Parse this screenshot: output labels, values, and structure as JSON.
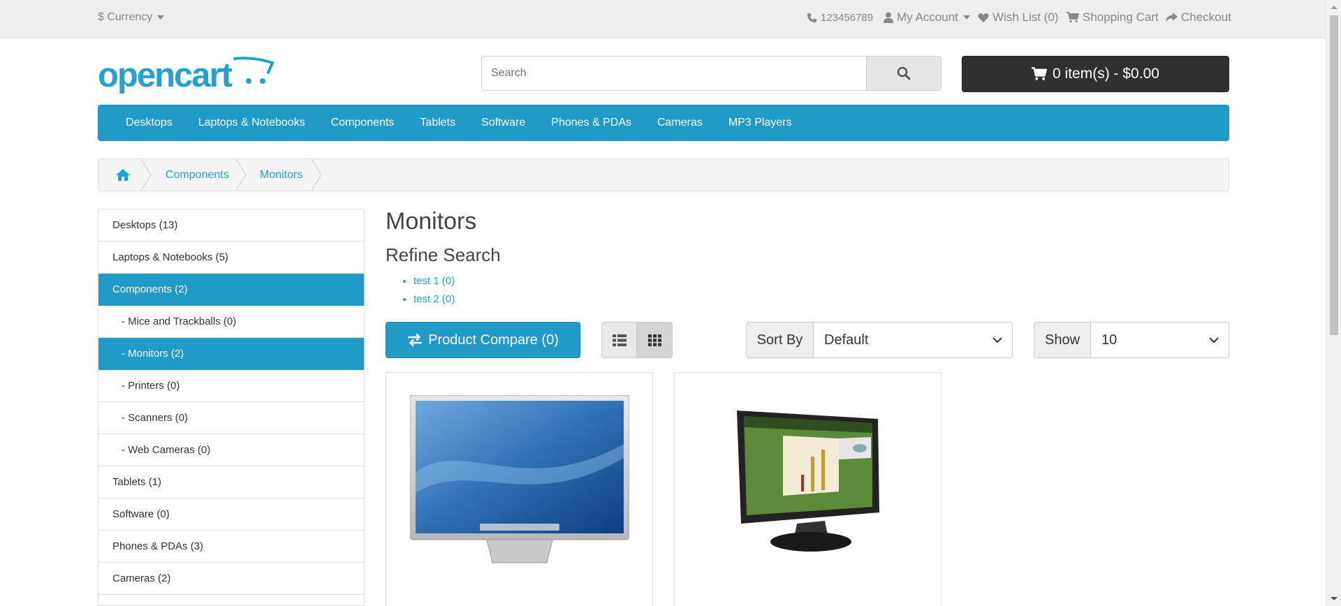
{
  "top_bar": {
    "currency": "$ Currency",
    "phone": "123456789",
    "my_account": "My Account",
    "wish_list": "Wish List (0)",
    "shopping_cart": "Shopping Cart",
    "checkout": "Checkout"
  },
  "logo": {
    "text": "opencart"
  },
  "search": {
    "placeholder": "Search"
  },
  "cart_button": {
    "label": "0 item(s) - $0.00"
  },
  "nav": {
    "items": [
      "Desktops",
      "Laptops & Notebooks",
      "Components",
      "Tablets",
      "Software",
      "Phones & PDAs",
      "Cameras",
      "MP3 Players"
    ]
  },
  "breadcrumb": {
    "items": [
      "Components",
      "Monitors"
    ]
  },
  "sidebar": {
    "items": [
      {
        "label": "Desktops (13)",
        "active": false,
        "sub": false
      },
      {
        "label": "Laptops & Notebooks (5)",
        "active": false,
        "sub": false
      },
      {
        "label": "Components (2)",
        "active": true,
        "sub": false
      },
      {
        "label": "- Mice and Trackballs (0)",
        "active": false,
        "sub": true
      },
      {
        "label": "- Monitors (2)",
        "active": true,
        "sub": true
      },
      {
        "label": "- Printers (0)",
        "active": false,
        "sub": true
      },
      {
        "label": "- Scanners (0)",
        "active": false,
        "sub": true
      },
      {
        "label": "- Web Cameras (0)",
        "active": false,
        "sub": true
      },
      {
        "label": "Tablets (1)",
        "active": false,
        "sub": false
      },
      {
        "label": "Software (0)",
        "active": false,
        "sub": false
      },
      {
        "label": "Phones & PDAs (3)",
        "active": false,
        "sub": false
      },
      {
        "label": "Cameras (2)",
        "active": false,
        "sub": false
      }
    ]
  },
  "main": {
    "title": "Monitors",
    "refine_title": "Refine Search",
    "refine_items": [
      "test 1 (0)",
      "test 2 (0)"
    ],
    "compare_label": "Product Compare (0)",
    "sort_label": "Sort By",
    "sort_value": "Default",
    "show_label": "Show",
    "show_value": "10"
  },
  "colors": {
    "accent": "#229ac8",
    "link": "#23a1d1",
    "cart_bg": "#303030",
    "top_bar_bg": "#eeeeee"
  }
}
